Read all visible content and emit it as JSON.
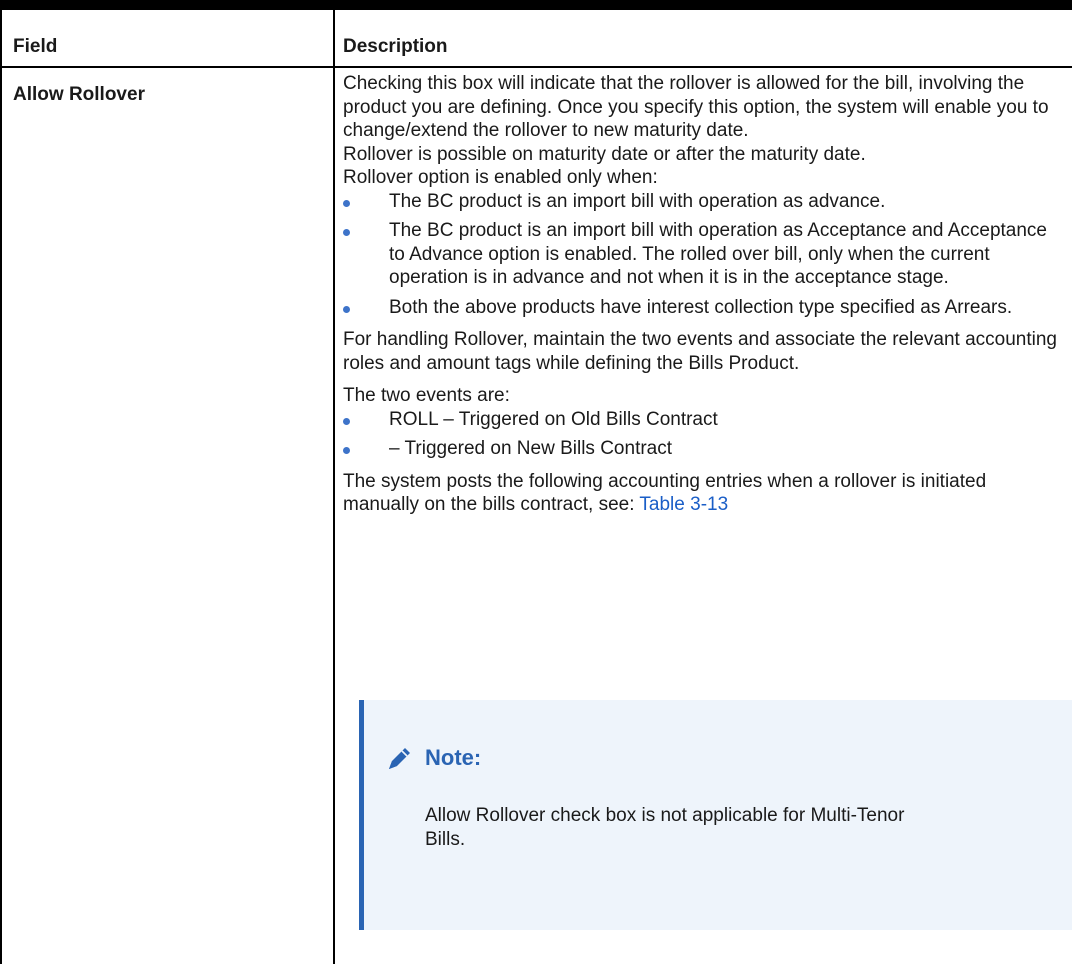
{
  "table": {
    "headers": {
      "field": "Field",
      "description": "Description"
    },
    "row": {
      "field": "Allow Rollover",
      "intro": "Checking this box will indicate that the rollover is allowed for the bill, involving the product you are defining. Once you specify this option, the system will enable you to change/extend the rollover to new maturity date.",
      "line2": "Rollover is possible on maturity date or after the maturity date.",
      "line3": "Rollover option is enabled only when:",
      "conditions": [
        "The BC product is an import bill with operation as advance.",
        "The BC product is an import bill with operation as Acceptance and Acceptance to Advance option is enabled. The rolled over bill, only when the current operation is in advance and not when it is in the acceptance stage.",
        "Both the above products have interest collection type specified as Arrears."
      ],
      "handling": "For handling Rollover, maintain the two events and associate the relevant accounting roles and amount tags while defining the Bills Product.",
      "events_intro": "The two events are:",
      "events": [
        "ROLL – Triggered on Old Bills Contract",
        "– Triggered on New Bills Contract"
      ],
      "entries_text": "The system posts the following accounting entries when a rollover is initiated manually on the bills contract, see: ",
      "entries_link": "Table 3-13",
      "note": {
        "icon": "pencil-icon",
        "title": "Note:",
        "body": "Allow Rollover check box is not applicable for Multi-Tenor Bills."
      }
    }
  },
  "colors": {
    "link": "#1a5ec7",
    "bullet": "#3d73c9",
    "note_bar": "#2a64b3",
    "note_bg": "#eef4fb"
  }
}
